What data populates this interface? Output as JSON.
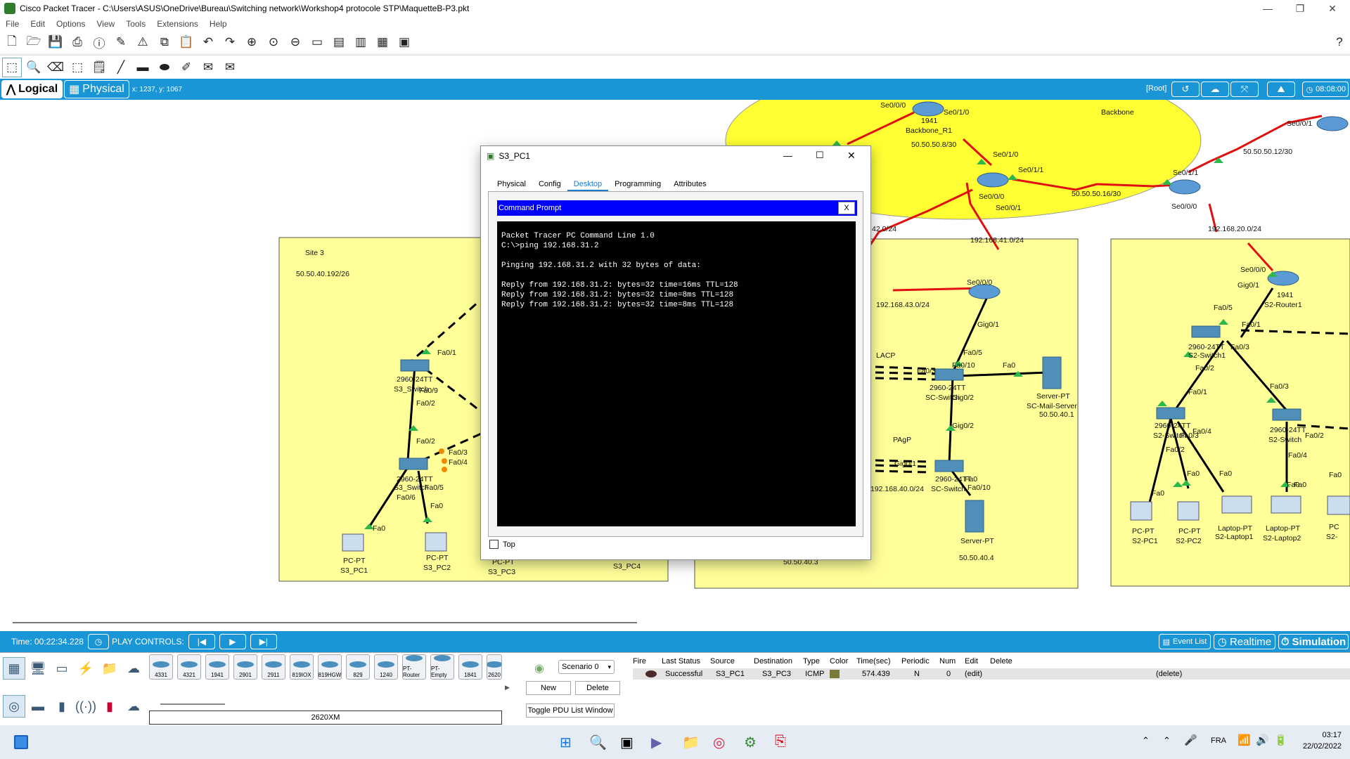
{
  "window": {
    "title": "Cisco Packet Tracer - C:\\Users\\ASUS\\OneDrive\\Bureau\\Switching network\\Workshop4 protocole STP\\MaquetteB-P3.pkt"
  },
  "menu": [
    "File",
    "Edit",
    "Options",
    "View",
    "Tools",
    "Extensions",
    "Help"
  ],
  "viewbar": {
    "logical": "Logical",
    "physical": "Physical",
    "coords": "x: 1237, y: 1067",
    "root": "[Root]",
    "clock": "08:08:00"
  },
  "topology": {
    "site3": {
      "title": "Site 3",
      "subnet": "50.50.40.192/26"
    },
    "backbone": {
      "title": "Backbone"
    },
    "labels": [
      "Se0/0/0",
      "Se0/1/0",
      "1941",
      "Backbone_R1",
      "50.50.50.8/30",
      "Se0/1/0",
      "Se0/1/1",
      "Se0/0/0",
      "Se0/0/1",
      "50.50.50.16/30",
      "Se0/1/1",
      "Se0/0/0",
      "Se0/0/1",
      "50.50.50.12/30",
      "192.168.41.0/24",
      "192.168.20.0/24",
      "Se0/0/0",
      "Se0/0/0",
      "Gig0/1",
      "1941",
      "S2-Router1",
      "192.168.43.0/24",
      "Gig0/1",
      "LACP",
      "Fa0/5",
      "Fa0/10",
      "Fa0/3",
      "Fa0",
      "2960-24TT",
      "SC-Switch",
      "Gig0/2",
      "Server-PT",
      "SC-Mail-Server",
      "50.50.40.1",
      "Gig0/2",
      "PAgP",
      "Gig0/1",
      "2960-24TT",
      "SC-Switch",
      "Fa0",
      "Fa0/10",
      "192.168.40.0/24",
      "Server-PT",
      "50.50.40.4",
      "50.50.40.3",
      "Fa0/5",
      "Fa0/1",
      "2960-24TT",
      "S2-Switch1",
      "Fa0/3",
      "Fa0/2",
      "Fa0/3",
      "Fa0/1",
      "2960-24TT",
      "S2-Switch",
      "Fa0/4",
      "Fa0/3",
      "2960-24TT",
      "S2-Switch",
      "Fa0/2",
      "Fa0/4",
      "Fa0/2",
      "Fa0",
      "Fa0",
      "Fa0",
      "Fa0",
      "PC-PT",
      "S2-PC1",
      "PC-PT",
      "S2-PC2",
      "Laptop-PT",
      "S2-Laptop1",
      "Laptop-PT",
      "S2-Laptop2",
      "PC",
      "S2-",
      "Fa0/1",
      "2960-24TT",
      "S3_Switch",
      "Fa0/9",
      "Fa0/2",
      "Fa0/2",
      "Fa0/3",
      "Fa0/4",
      "2960-24TT",
      "S3_Switch",
      "Fa0/6",
      "Fa0/5",
      "Fa0",
      "Fa0",
      "PC-PT",
      "S3_PC1",
      "PC-PT",
      "S3_PC2",
      "PC-PT",
      "S3_PC3",
      "S3_PC4",
      "42.0/24",
      "Fa0",
      "Fa0"
    ]
  },
  "dialog": {
    "title": "S3_PC1",
    "tabs": [
      "Physical",
      "Config",
      "Desktop",
      "Programming",
      "Attributes"
    ],
    "active_tab": "Desktop",
    "cmd_title": "Command Prompt",
    "cmd_close": "X",
    "terminal": [
      "Packet Tracer PC Command Line 1.0",
      "C:\\>ping 192.168.31.2",
      "",
      "Pinging 192.168.31.2 with 32 bytes of data:",
      "",
      "Reply from 192.168.31.2: bytes=32 time=16ms TTL=128",
      "Reply from 192.168.31.2: bytes=32 time=8ms TTL=128",
      "Reply from 192.168.31.2: bytes=32 time=8ms TTL=128"
    ],
    "top_label": "Top"
  },
  "playbar": {
    "time": "Time: 00:22:34.228",
    "play_controls": "PLAY CONTROLS:",
    "event_list": "Event List",
    "realtime": "Realtime",
    "simulation": "Simulation"
  },
  "device_models": [
    "4331",
    "4321",
    "1941",
    "2901",
    "2911",
    "819IOX",
    "819HGW",
    "829",
    "1240",
    "PT-Router",
    "PT-Empty",
    "1841",
    "2620"
  ],
  "selected_model": "2620XM",
  "scenario": {
    "select": "Scenario 0",
    "new": "New",
    "delete": "Delete",
    "toggle": "Toggle PDU List Window"
  },
  "pdu": {
    "headers": [
      "Fire",
      "Last Status",
      "Source",
      "Destination",
      "Type",
      "Color",
      "Time(sec)",
      "Periodic",
      "Num",
      "Edit",
      "Delete"
    ],
    "rows": [
      {
        "status": "Successful",
        "source": "S3_PC1",
        "destination": "S3_PC3",
        "type": "ICMP",
        "color": "#7a7a3a",
        "time": "574.439",
        "periodic": "N",
        "num": "0",
        "edit": "(edit)",
        "delete": "(delete)"
      }
    ]
  },
  "taskbar": {
    "lang": "FRA",
    "time": "03:17",
    "date": "22/02/2022"
  }
}
